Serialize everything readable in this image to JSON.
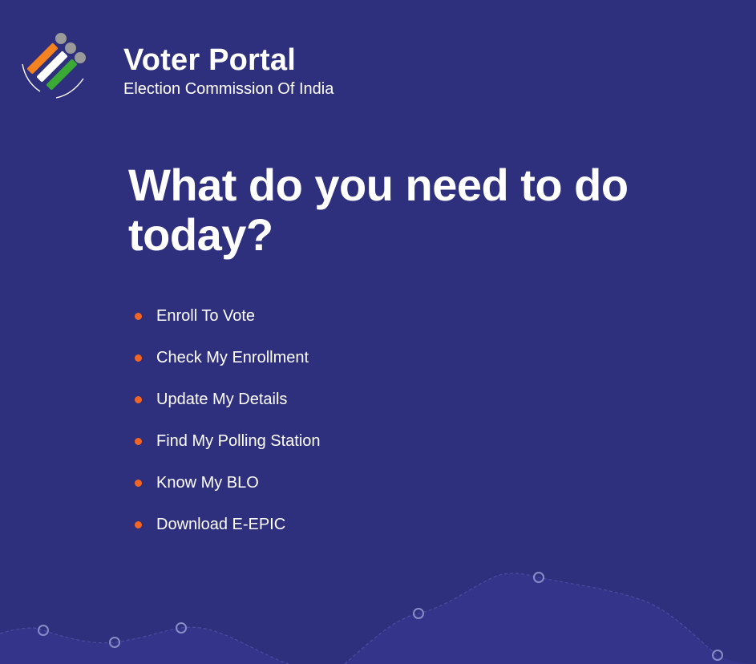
{
  "header": {
    "title": "Voter Portal",
    "subtitle": "Election Commission Of India"
  },
  "main": {
    "heading": "What do you need to do today?",
    "tasks": [
      {
        "label": "Enroll To Vote"
      },
      {
        "label": "Check My Enrollment"
      },
      {
        "label": "Update My Details"
      },
      {
        "label": "Find My Polling Station"
      },
      {
        "label": "Know My BLO"
      },
      {
        "label": "Download E-EPIC"
      }
    ]
  },
  "colors": {
    "background": "#2e2f7d",
    "bullet": "#f26522",
    "logo_orange": "#f58220",
    "logo_white": "#ffffff",
    "logo_green": "#3aaa35",
    "logo_circle": "#9a9a9a",
    "decor_wave": "#34358a",
    "decor_node": "#8a8cc8"
  }
}
